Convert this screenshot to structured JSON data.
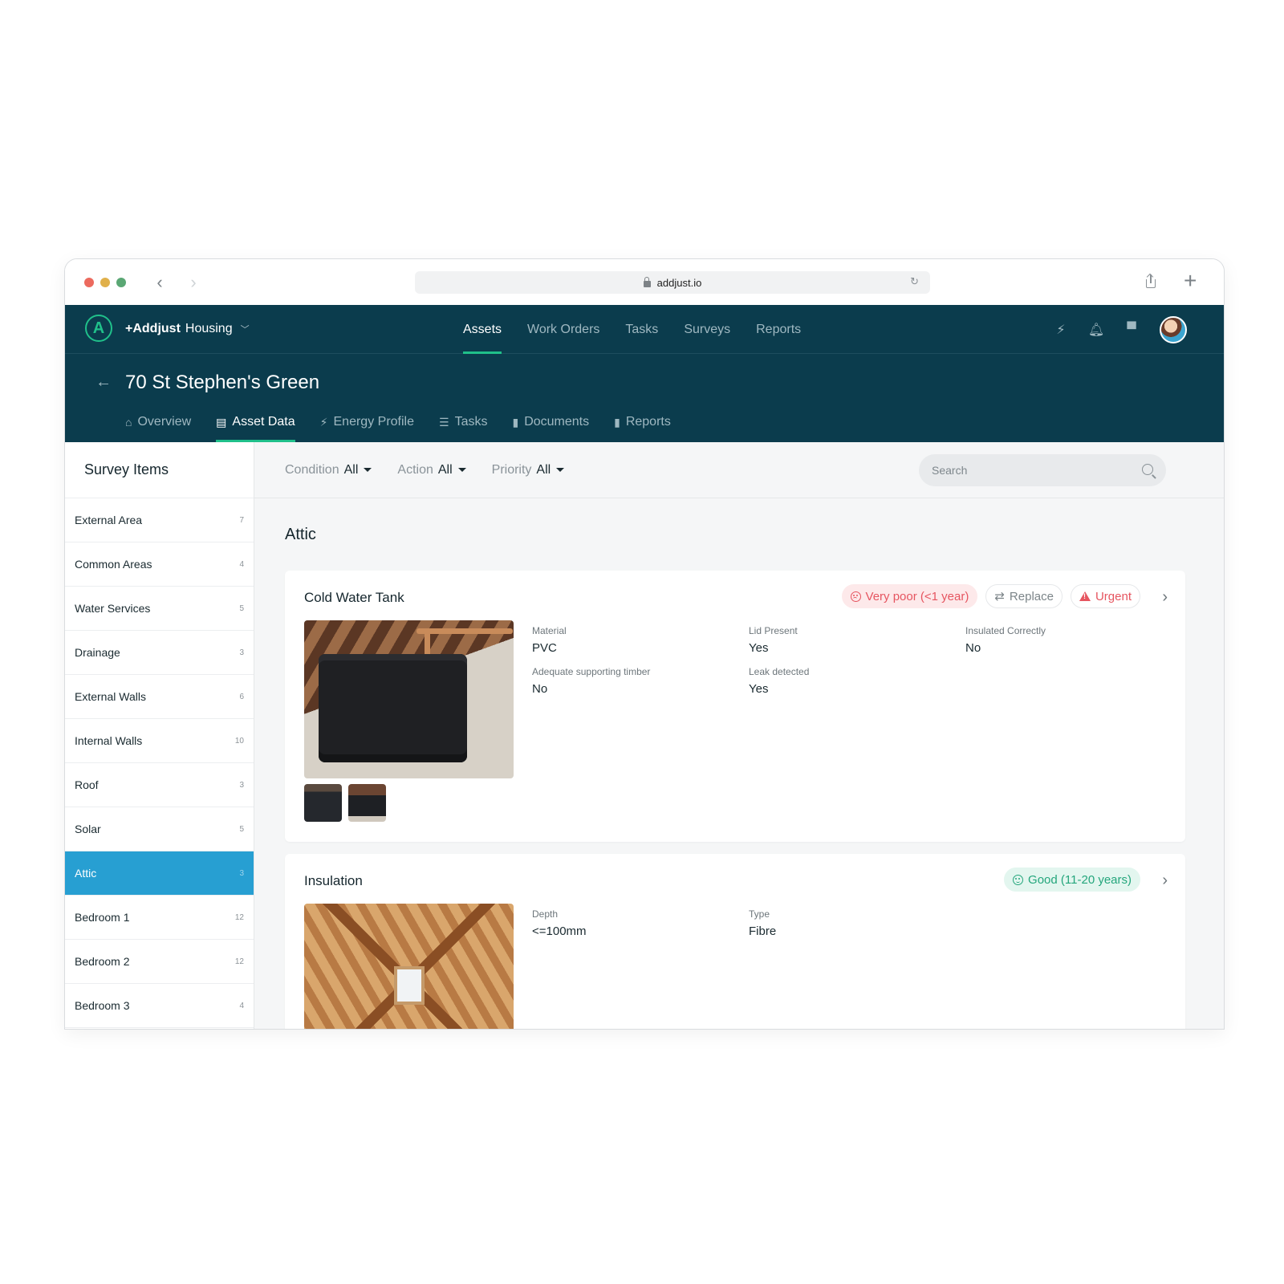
{
  "browser": {
    "url": "addjust.io"
  },
  "topnav": {
    "org_name_bold": "+Addjust",
    "org_name_rest": "Housing",
    "items": [
      {
        "label": "Assets",
        "active": true
      },
      {
        "label": "Work Orders",
        "active": false
      },
      {
        "label": "Tasks",
        "active": false
      },
      {
        "label": "Surveys",
        "active": false
      },
      {
        "label": "Reports",
        "active": false
      }
    ],
    "icons": [
      "lightning-icon",
      "bell-icon",
      "chat-icon",
      "avatar"
    ]
  },
  "page": {
    "title": "70 St Stephen's Green",
    "tabs": [
      {
        "label": "Overview",
        "icon": "home-icon",
        "active": false
      },
      {
        "label": "Asset Data",
        "icon": "document-icon",
        "active": true
      },
      {
        "label": "Energy Profile",
        "icon": "lightning-icon",
        "active": false
      },
      {
        "label": "Tasks",
        "icon": "checklist-icon",
        "active": false
      },
      {
        "label": "Documents",
        "icon": "file-icon",
        "active": false
      },
      {
        "label": "Reports",
        "icon": "file-icon",
        "active": false
      }
    ]
  },
  "sidebar": {
    "title": "Survey Items",
    "items": [
      {
        "label": "External Area",
        "count": "7"
      },
      {
        "label": "Common Areas",
        "count": "4"
      },
      {
        "label": "Water Services",
        "count": "5"
      },
      {
        "label": "Drainage",
        "count": "3"
      },
      {
        "label": "External Walls",
        "count": "6"
      },
      {
        "label": "Internal Walls",
        "count": "10"
      },
      {
        "label": "Roof",
        "count": "3"
      },
      {
        "label": "Solar",
        "count": "5"
      },
      {
        "label": "Attic",
        "count": "3",
        "active": true
      },
      {
        "label": "Bedroom 1",
        "count": "12"
      },
      {
        "label": "Bedroom 2",
        "count": "12"
      },
      {
        "label": "Bedroom 3",
        "count": "4"
      }
    ]
  },
  "filters": {
    "condition": {
      "label": "Condition",
      "value": "All"
    },
    "action": {
      "label": "Action",
      "value": "All"
    },
    "priority": {
      "label": "Priority",
      "value": "All"
    },
    "search_placeholder": "Search"
  },
  "section": {
    "title": "Attic"
  },
  "cards": [
    {
      "title": "Cold Water Tank",
      "badges": {
        "condition": "Very poor (<1 year)",
        "action": "Replace",
        "priority": "Urgent"
      },
      "props": [
        {
          "k": "Material",
          "v": "PVC"
        },
        {
          "k": "Lid Present",
          "v": "Yes"
        },
        {
          "k": "Insulated Correctly",
          "v": "No"
        },
        {
          "k": "Adequate supporting timber",
          "v": "No"
        },
        {
          "k": "Leak detected",
          "v": "Yes"
        }
      ]
    },
    {
      "title": "Insulation",
      "badges": {
        "condition": "Good (11-20 years)"
      },
      "props": [
        {
          "k": "Depth",
          "v": "<=100mm"
        },
        {
          "k": "Type",
          "v": "Fibre"
        }
      ]
    }
  ],
  "colors": {
    "nav_bg": "#0b3c4d",
    "accent_green": "#20c08a",
    "sidebar_active": "#279fd2",
    "poor": "#e65560",
    "good": "#24a67c"
  }
}
